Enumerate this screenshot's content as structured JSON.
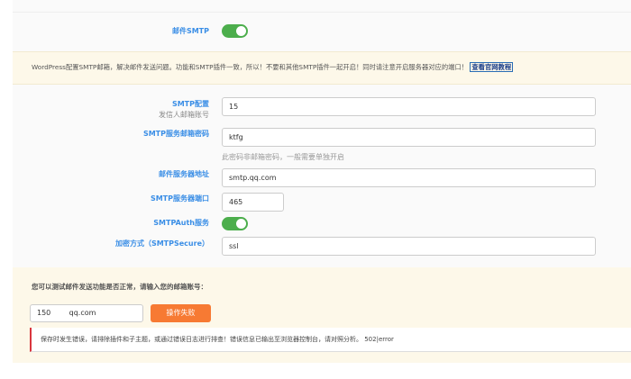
{
  "smtp_toggle": {
    "label": "邮件SMTP",
    "on": true
  },
  "notice": {
    "text": "WordPress配置SMTP邮箱，解决邮件发送问题。功能和SMTP插件一致，所以！不要和其他SMTP插件一起开启！同时请注意开启服务器对应的端口！",
    "link": "查看官网教程"
  },
  "form": {
    "from_label": "SMTP配置",
    "from_sub": "发信人邮箱账号",
    "from_value": "15",
    "pass_label": "SMTP服务邮箱密码",
    "pass_value": "ktfg",
    "pass_hint": "此密码非邮箱密码，一般需要单独开启",
    "host_label": "邮件服务器地址",
    "host_value": "smtp.qq.com",
    "port_label": "SMTP服务器端口",
    "port_value": "465",
    "auth_label": "SMTPAuth服务",
    "auth_on": true,
    "secure_label": "加密方式（SMTPSecure）",
    "secure_value": "ssl"
  },
  "test": {
    "prompt": "您可以测试邮件发送功能是否正常，请输入您的邮箱账号：",
    "email_value": "150        qq.com",
    "button": "操作失败",
    "error": "保存时发生错误，请排除插件和子主题，或通过错误日志进行排查！错误信息已输出至浏览器控制台，请对照分析。 502|error"
  },
  "colors": {
    "accent": "#3a8ee6",
    "toggle_on": "#4cae4c",
    "button": "#f77a33",
    "error": "#d9363e"
  }
}
